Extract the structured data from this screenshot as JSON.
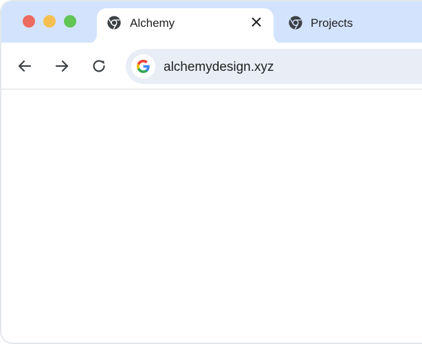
{
  "window": {
    "traffic_lights": [
      {
        "name": "close",
        "color": "#ed6a5e"
      },
      {
        "name": "minimize",
        "color": "#f5bf4f"
      },
      {
        "name": "maximize",
        "color": "#62c554"
      }
    ]
  },
  "tabs": [
    {
      "label": "Alchemy",
      "icon": "chrome-icon",
      "active": true,
      "close_icon": "close-icon"
    },
    {
      "label": "Projects",
      "icon": "chrome-icon",
      "active": false
    }
  ],
  "toolbar": {
    "back_icon": "arrow-left-icon",
    "forward_icon": "arrow-right-icon",
    "reload_icon": "reload-icon",
    "site_icon": "google-g-icon",
    "url": "alchemydesign.xyz"
  },
  "colors": {
    "tabbar_bg": "#d3e3fd",
    "omnibox_bg": "#e9eef6",
    "icon_dark": "#3c4043"
  }
}
